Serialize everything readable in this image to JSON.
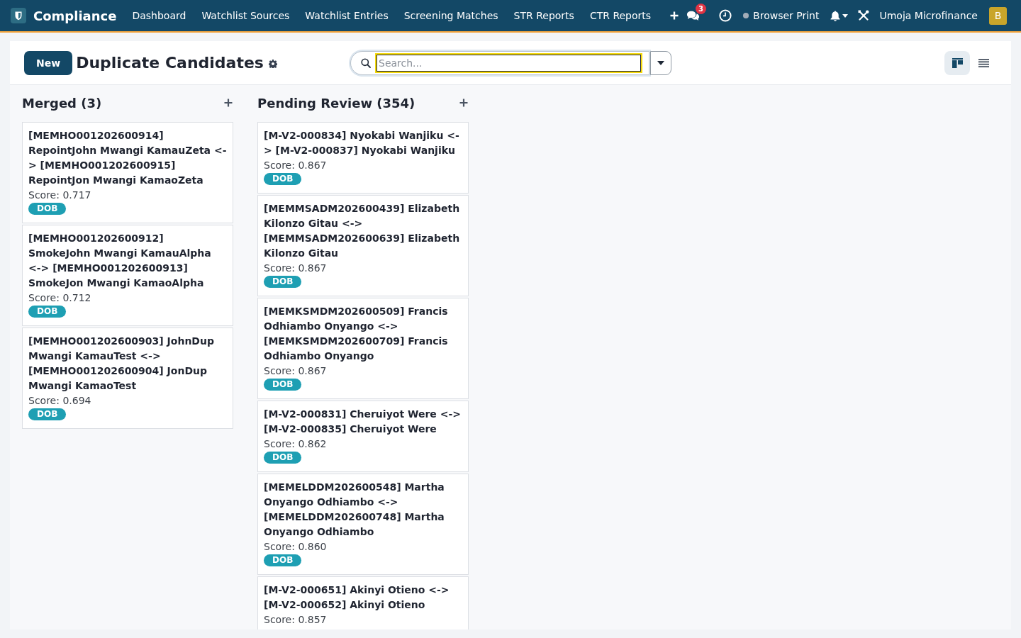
{
  "navbar": {
    "app_name": "Compliance",
    "menu": [
      "Dashboard",
      "Watchlist Sources",
      "Watchlist Entries",
      "Screening Matches",
      "STR Reports",
      "CTR Reports"
    ],
    "message_count": "3",
    "printer": "Browser Print",
    "company": "Umoja Microfinance",
    "avatar": "B"
  },
  "control_panel": {
    "new_button": "New",
    "title": "Duplicate Candidates",
    "search": {
      "placeholder": "Search..."
    },
    "views": [
      {
        "kind": "kanban",
        "selected": true
      },
      {
        "kind": "list",
        "selected": false
      }
    ]
  },
  "columns": [
    {
      "title": "Merged (3)",
      "cards": [
        {
          "title": "[MEMHO001202600914] RepointJohn Mwangi KamauZeta <-> [MEMHO001202600915] RepointJon Mwangi KamaoZeta",
          "score": "Score: 0.717",
          "tags": [
            "DOB"
          ]
        },
        {
          "title": "[MEMHO001202600912] SmokeJohn Mwangi KamauAlpha <-> [MEMHO001202600913] SmokeJon Mwangi KamaoAlpha",
          "score": "Score: 0.712",
          "tags": [
            "DOB"
          ]
        },
        {
          "title": "[MEMHO001202600903] JohnDup Mwangi KamauTest <-> [MEMHO001202600904] JonDup Mwangi KamaoTest",
          "score": "Score: 0.694",
          "tags": [
            "DOB"
          ]
        }
      ]
    },
    {
      "title": "Pending Review (354)",
      "cards": [
        {
          "title": "[M-V2-000834] Nyokabi Wanjiku <-> [M-V2-000837] Nyokabi Wanjiku",
          "score": "Score: 0.867",
          "tags": [
            "DOB"
          ]
        },
        {
          "title": "[MEMMSADM202600439] Elizabeth Kilonzo Gitau <-> [MEMMSADM202600639] Elizabeth Kilonzo Gitau",
          "score": "Score: 0.867",
          "tags": [
            "DOB"
          ]
        },
        {
          "title": "[MEMKSMDM202600509] Francis Odhiambo Onyango <-> [MEMKSMDM202600709] Francis Odhiambo Onyango",
          "score": "Score: 0.867",
          "tags": [
            "DOB"
          ]
        },
        {
          "title": "[M-V2-000831] Cheruiyot Were <-> [M-V2-000835] Cheruiyot Were",
          "score": "Score: 0.862",
          "tags": [
            "DOB"
          ]
        },
        {
          "title": "[MEMELDDM202600548] Martha Onyango Odhiambo <-> [MEMELDDM202600748] Martha Onyango Odhiambo",
          "score": "Score: 0.860",
          "tags": [
            "DOB"
          ]
        },
        {
          "title": "[M-V2-000651] Akinyi Otieno <-> [M-V2-000652] Akinyi Otieno",
          "score": "Score: 0.857"
        }
      ]
    }
  ]
}
